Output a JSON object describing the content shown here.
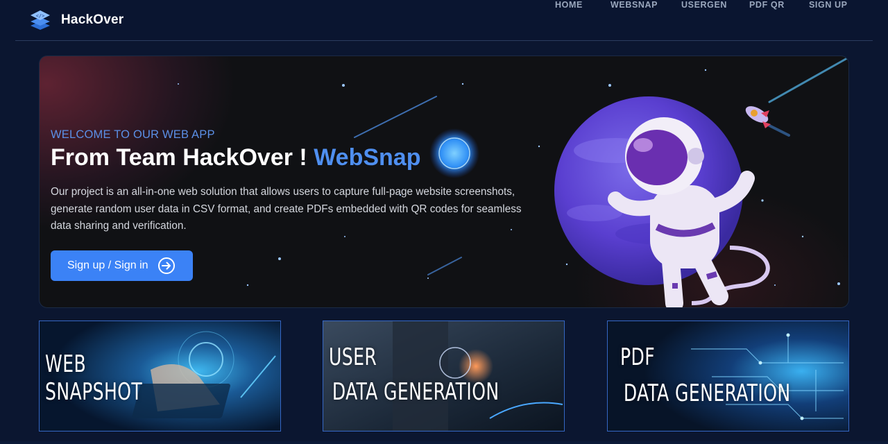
{
  "nav": {
    "brand": "HackOver",
    "links": [
      {
        "label": "HOME"
      },
      {
        "label": "WEBSNAP"
      },
      {
        "label": "USERGEN"
      },
      {
        "label": "PDF QR"
      },
      {
        "label": "SIGN UP"
      }
    ]
  },
  "hero": {
    "welcome": "WELCOME TO OUR WEB APP",
    "headline_main": "From Team HackOver ! ",
    "headline_accent": "WebSnap",
    "description": "Our project is an all-in-one web solution that allows users to capture full-page website screenshots, generate random user data in CSV format, and create PDFs embedded with QR codes for seamless data sharing and verification.",
    "cta_label": "Sign up / Sign in",
    "cta_icon": "arrow-right-circle-icon"
  },
  "cards": [
    {
      "line1": "WEB",
      "line2": "SNAPSHOT"
    },
    {
      "line1": "USER",
      "line2": "DATA GENERATION"
    },
    {
      "line1": "PDF",
      "line2": "DATA GENERATION"
    }
  ],
  "colors": {
    "accent": "#3b82f6",
    "headline_accent": "#4f8ff0",
    "background": "#0b1630",
    "card_border": "#3567c4"
  }
}
